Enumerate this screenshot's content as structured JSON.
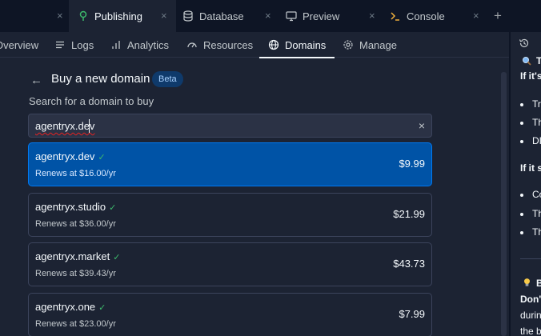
{
  "tabs": [
    {
      "label": ""
    },
    {
      "label": "Publishing",
      "active": true
    },
    {
      "label": "Database"
    },
    {
      "label": "Preview"
    },
    {
      "label": "Console"
    }
  ],
  "nav": [
    {
      "label": "Overview"
    },
    {
      "label": "Logs"
    },
    {
      "label": "Analytics"
    },
    {
      "label": "Resources"
    },
    {
      "label": "Domains",
      "active": true
    },
    {
      "label": "Manage"
    }
  ],
  "page": {
    "title": "Buy a new domain",
    "badge": "Beta",
    "search_label": "Search for a domain to buy",
    "search_value": "agentryx.dev"
  },
  "results": [
    {
      "name": "agentryx.dev",
      "renew": "Renews at $16.00/yr",
      "price": "$9.99",
      "selected": true
    },
    {
      "name": "agentryx.studio",
      "renew": "Renews at $36.00/yr",
      "price": "$21.99"
    },
    {
      "name": "agentryx.market",
      "renew": "Renews at $39.43/yr",
      "price": "$43.73"
    },
    {
      "name": "agentryx.one",
      "renew": "Renews at $23.00/yr",
      "price": "$7.99"
    }
  ],
  "right_panel": {
    "heading1": "T",
    "line1": "If it's",
    "bullets1": [
      "Tr",
      "Th",
      "DI"
    ],
    "line2": "If it s",
    "bullets2": [
      "Co",
      "Th",
      "Th"
    ],
    "heading2": "B",
    "line3": "Don'",
    "line4": "durin",
    "line5": "the b"
  },
  "colors": {
    "accent": "#0079f2",
    "selected_bg": "#0053a6",
    "success": "#3dba6c",
    "background": "#1c2333",
    "tabbar": "#0e1525"
  },
  "icons": {
    "check": "✓",
    "close": "×",
    "plus": "+",
    "back": "←"
  }
}
